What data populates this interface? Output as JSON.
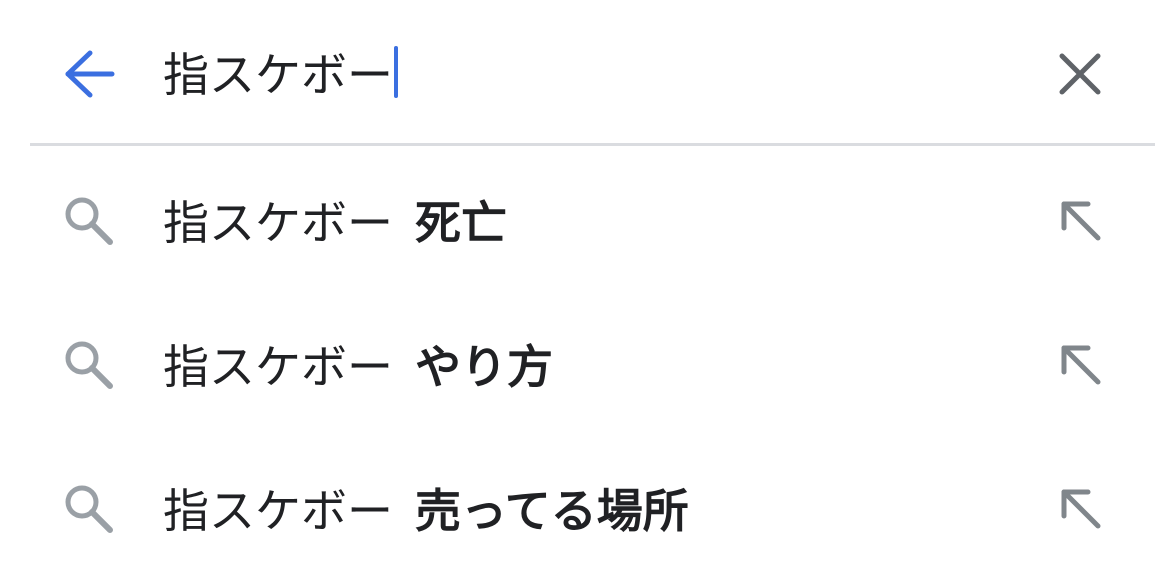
{
  "search": {
    "query": "指スケボー",
    "back_icon": "arrow-left-icon",
    "clear_icon": "close-icon",
    "accent_color": "#3b6fe0"
  },
  "suggestions": [
    {
      "prefix": "指スケボー",
      "completion": "死亡",
      "icon": "search-icon",
      "action_icon": "arrow-up-left-icon"
    },
    {
      "prefix": "指スケボー",
      "completion": "やり方",
      "icon": "search-icon",
      "action_icon": "arrow-up-left-icon"
    },
    {
      "prefix": "指スケボー",
      "completion": "売ってる場所",
      "icon": "search-icon",
      "action_icon": "arrow-up-left-icon"
    }
  ]
}
